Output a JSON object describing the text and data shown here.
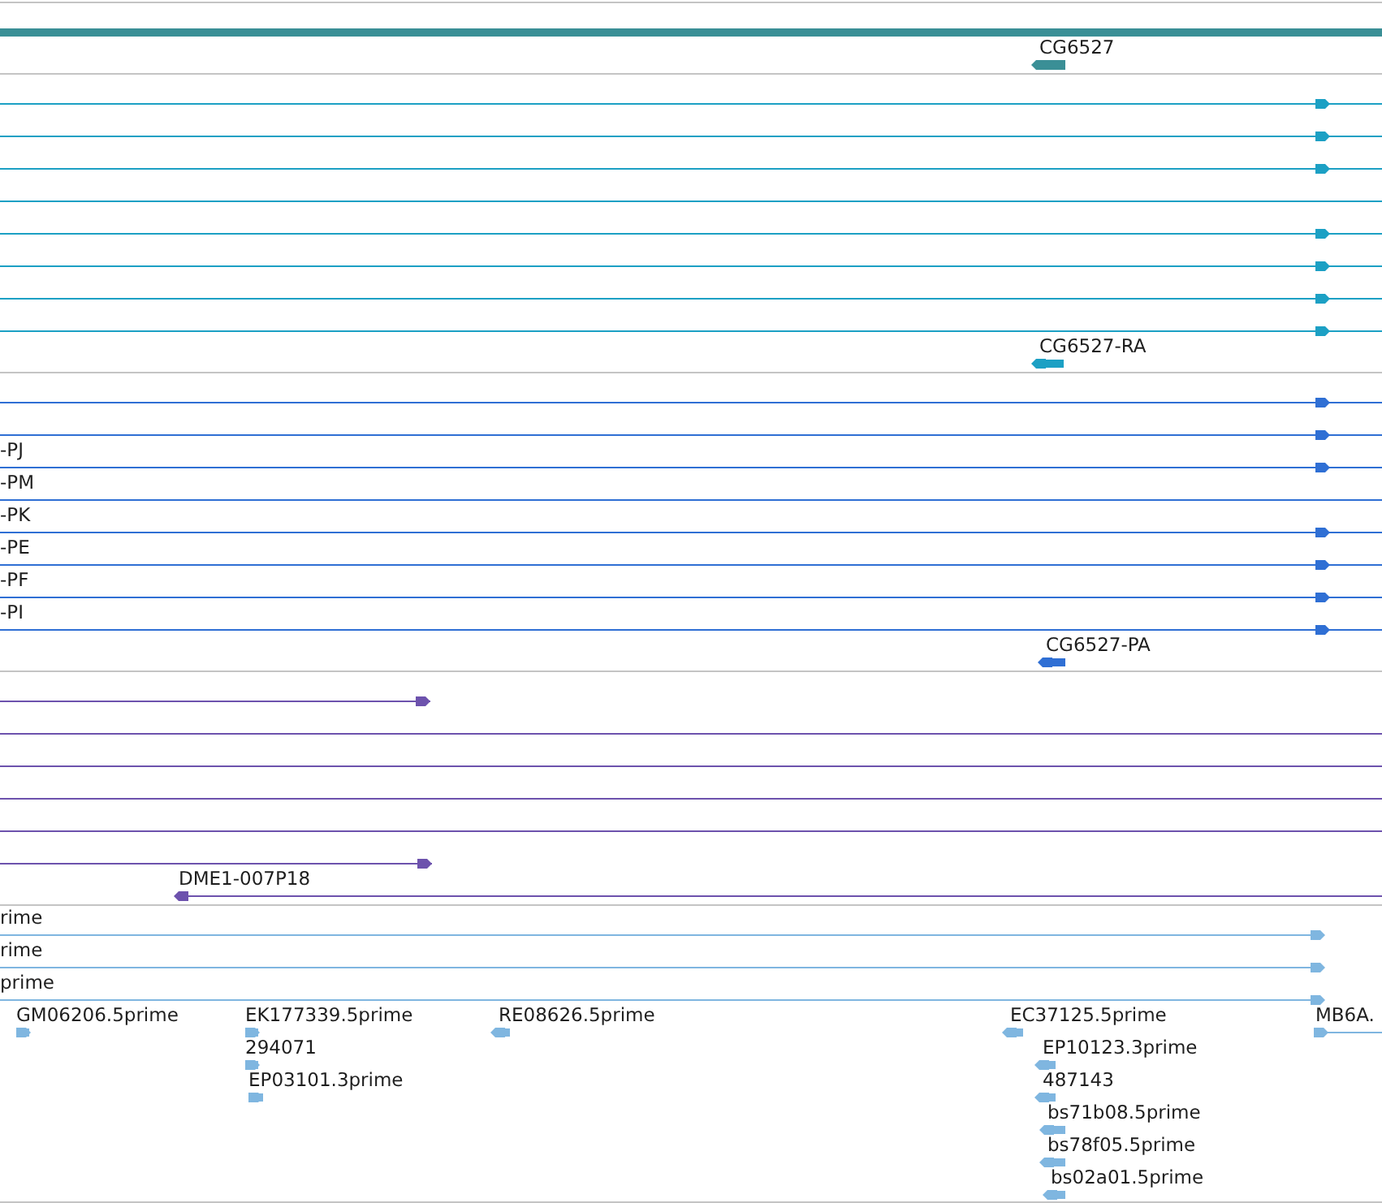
{
  "tracks": [
    {
      "color": "#3a8f96",
      "features": [
        {
          "kind": "plain"
        },
        {
          "label": "CG6527",
          "kind": "reverse"
        }
      ]
    },
    {
      "color": "#1ca0c4",
      "features": [
        {
          "kind": "forward"
        },
        {
          "kind": "forward"
        },
        {
          "kind": "forward"
        },
        {
          "kind": "plain"
        },
        {
          "kind": "forward"
        },
        {
          "kind": "forward"
        },
        {
          "kind": "forward"
        },
        {
          "kind": "forward"
        },
        {
          "label": "CG6527-RA",
          "kind": "reverse"
        }
      ]
    },
    {
      "color": "#2f6fd4",
      "features": [
        {
          "kind": "forward"
        },
        {
          "kind": "forward"
        },
        {
          "label": "-PJ",
          "kind": "forward"
        },
        {
          "label": "-PM",
          "kind": "plain"
        },
        {
          "label": "-PK",
          "kind": "forward"
        },
        {
          "label": "-PE",
          "kind": "forward"
        },
        {
          "label": "-PF",
          "kind": "forward"
        },
        {
          "label": "-PI",
          "kind": "forward"
        },
        {
          "label": "CG6527-PA",
          "kind": "reverse"
        }
      ]
    },
    {
      "color": "#6d52ad",
      "features": [
        {
          "kind": "forward"
        },
        {
          "kind": "plain"
        },
        {
          "kind": "plain"
        },
        {
          "kind": "plain"
        },
        {
          "kind": "plain"
        },
        {
          "kind": "forward"
        },
        {
          "label": "DME1-007P18",
          "kind": "reverse"
        }
      ]
    },
    {
      "color": "#7fb6e0",
      "features": [
        {
          "label": "rime",
          "kind": "forward"
        },
        {
          "label": "rime",
          "kind": "forward"
        },
        {
          "label": "prime",
          "kind": "forward"
        },
        {
          "label": "GM06206.5prime",
          "kind": "forward"
        },
        {
          "label": "EK177339.5prime",
          "kind": "forward"
        },
        {
          "label": "294071",
          "kind": "forward"
        },
        {
          "label": "EP03101.3prime",
          "kind": "forward"
        },
        {
          "label": "RE08626.5prime",
          "kind": "reverse"
        },
        {
          "label": "EC37125.5prime",
          "kind": "reverse"
        },
        {
          "label": "EP10123.3prime",
          "kind": "reverse"
        },
        {
          "label": "487143",
          "kind": "reverse"
        },
        {
          "label": "bs71b08.5prime",
          "kind": "reverse"
        },
        {
          "label": "bs78f05.5prime",
          "kind": "reverse"
        },
        {
          "label": "bs02a01.5prime",
          "kind": "reverse"
        },
        {
          "label": "MB6A.",
          "kind": "forward"
        }
      ]
    }
  ]
}
